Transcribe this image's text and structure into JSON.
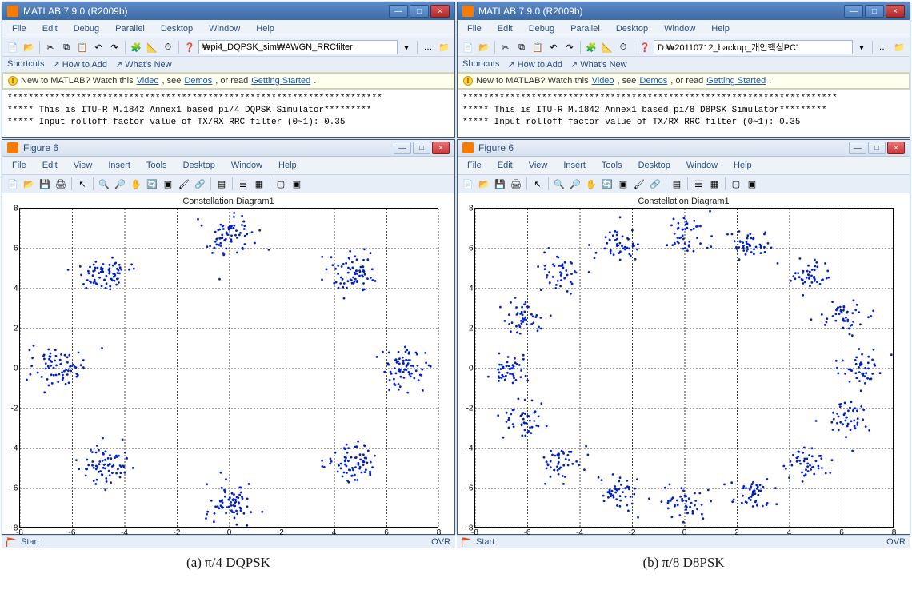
{
  "panes": [
    {
      "main_title": "MATLAB  7.9.0 (R2009b)",
      "menu": [
        "File",
        "Edit",
        "Debug",
        "Parallel",
        "Desktop",
        "Window",
        "Help"
      ],
      "path_value": "₩pi4_DQPSK_sim₩AWGN_RRCfilter",
      "shortcuts_label": "Shortcuts",
      "shortcuts_items": [
        "How to Add",
        "What's New"
      ],
      "info_prefix": "New to MATLAB? Watch this ",
      "info_link1": "Video",
      "info_mid1": ", see ",
      "info_link2": "Demos",
      "info_mid2": ", or read ",
      "info_link3": "Getting Started",
      "info_suffix": ".",
      "cmd_lines": [
        "***********************************************************************",
        "***** This is ITU-R M.1842 Annex1 based pi/4 DQPSK Simulator*********",
        "***** Input rolloff factor value of TX/RX RRC filter (0~1): 0.35"
      ],
      "figure_title": "Figure 6",
      "figure_menu": [
        "File",
        "Edit",
        "View",
        "Insert",
        "Tools",
        "Desktop",
        "Window",
        "Help"
      ],
      "plot_title": "Constellation Diagram1",
      "axes": {
        "xmin": -8,
        "xmax": 8,
        "ymin": -8,
        "ymax": 8,
        "xticks": [
          -8,
          -6,
          -4,
          -2,
          0,
          2,
          4,
          6,
          8
        ],
        "yticks": [
          -8,
          -6,
          -4,
          -2,
          0,
          2,
          4,
          6,
          8
        ]
      },
      "status_left": "Start",
      "status_right": "OVR",
      "caption": "(a)  π/4 DQPSK",
      "chart_data": {
        "type": "scatter",
        "title": "Constellation Diagram1",
        "xlim": [
          -8,
          8
        ],
        "ylim": [
          -8,
          8
        ],
        "description": "8 noisy clusters on a circle of radius ≈ 6.7, at multiples of 45° (π/4 DQPSK constellation with AWGN)",
        "cluster_centers": [
          [
            6.7,
            0
          ],
          [
            4.74,
            4.74
          ],
          [
            0,
            6.7
          ],
          [
            -4.74,
            4.74
          ],
          [
            -6.7,
            0
          ],
          [
            -4.74,
            -4.74
          ],
          [
            0,
            -6.7
          ],
          [
            4.74,
            -4.74
          ]
        ],
        "points_per_cluster": 70,
        "noise_sigma": 0.5
      }
    },
    {
      "main_title": "MATLAB  7.9.0 (R2009b)",
      "menu": [
        "File",
        "Edit",
        "Debug",
        "Parallel",
        "Desktop",
        "Window",
        "Help"
      ],
      "path_value": "D:₩20110712_backup_개인핵심PC'",
      "shortcuts_label": "Shortcuts",
      "shortcuts_items": [
        "How to Add",
        "What's New"
      ],
      "info_prefix": "New to MATLAB? Watch this ",
      "info_link1": "Video",
      "info_mid1": ", see ",
      "info_link2": "Demos",
      "info_mid2": ", or read ",
      "info_link3": "Getting Started",
      "info_suffix": ".",
      "cmd_lines": [
        "***********************************************************************",
        "***** This is ITU-R M.1842 Annex1 based pi/8 D8PSK Simulator*********",
        "***** Input rolloff factor value of TX/RX RRC filter (0~1): 0.35"
      ],
      "figure_title": "Figure 6",
      "figure_menu": [
        "File",
        "Edit",
        "View",
        "Insert",
        "Tools",
        "Desktop",
        "Window",
        "Help"
      ],
      "plot_title": "Constellation Diagram1",
      "axes": {
        "xmin": -8,
        "xmax": 8,
        "ymin": -8,
        "ymax": 8,
        "xticks": [
          -8,
          -6,
          -4,
          -2,
          0,
          2,
          4,
          6,
          8
        ],
        "yticks": [
          -8,
          -6,
          -4,
          -2,
          0,
          2,
          4,
          6,
          8
        ]
      },
      "status_left": "Start",
      "status_right": "OVR",
      "caption": "(b)  π/8 D8PSK",
      "chart_data": {
        "type": "scatter",
        "title": "Constellation Diagram1",
        "xlim": [
          -8,
          8
        ],
        "ylim": [
          -8,
          8
        ],
        "description": "16 noisy clusters on a circle of radius ≈ 6.7, at multiples of 22.5° (π/8 D8PSK constellation with AWGN)",
        "cluster_centers": [
          [
            6.7,
            0
          ],
          [
            6.19,
            2.56
          ],
          [
            4.74,
            4.74
          ],
          [
            2.56,
            6.19
          ],
          [
            0,
            6.7
          ],
          [
            -2.56,
            6.19
          ],
          [
            -4.74,
            4.74
          ],
          [
            -6.19,
            2.56
          ],
          [
            -6.7,
            0
          ],
          [
            -6.19,
            -2.56
          ],
          [
            -4.74,
            -4.74
          ],
          [
            -2.56,
            -6.19
          ],
          [
            0,
            -6.7
          ],
          [
            2.56,
            -6.19
          ],
          [
            4.74,
            -4.74
          ],
          [
            6.19,
            -2.56
          ]
        ],
        "points_per_cluster": 45,
        "noise_sigma": 0.42
      }
    }
  ],
  "icons": {
    "new": "□",
    "open": "📂",
    "cut": "✂",
    "copy": "⧉",
    "paste": "📋",
    "undo": "↶",
    "redo": "↷",
    "simulink": "▦",
    "help": "?",
    "folder": "📁",
    "go": "…",
    "arrow": "▶",
    "save": "💾",
    "print": "🖨",
    "pointer": "↖",
    "zoomin": "🔍+",
    "zoomout": "🔍-",
    "pan": "✋",
    "rotate": "🔄",
    "datatip": "☰",
    "brush": "🖌",
    "link": "🔗",
    "colorbar": "▤",
    "legend": "☰",
    "subplot": "▦"
  }
}
